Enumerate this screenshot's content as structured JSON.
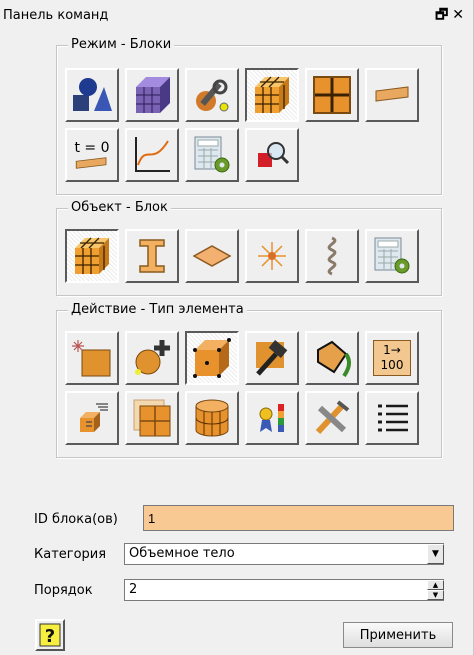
{
  "window": {
    "title": "Панель команд",
    "restore_icon": "restore-icon",
    "close_icon": "close-icon"
  },
  "groups": {
    "mode": {
      "label": "Режим - Блоки",
      "buttons": [
        {
          "name": "geometry-shapes-icon",
          "pressed": false
        },
        {
          "name": "mesh-cube-icon",
          "pressed": false
        },
        {
          "name": "tools-wrench-icon",
          "pressed": false
        },
        {
          "name": "block-cube-icon",
          "pressed": true
        },
        {
          "name": "grid-split-icon",
          "pressed": false
        },
        {
          "name": "plank-icon",
          "pressed": false
        },
        {
          "name": "initial-condition-icon",
          "label": "t = 0",
          "pressed": false
        },
        {
          "name": "graph-curve-icon",
          "pressed": false
        },
        {
          "name": "calculator-gear-icon",
          "pressed": false
        },
        {
          "name": "magnifier-icon",
          "pressed": false
        }
      ]
    },
    "object": {
      "label": "Объект - Блок",
      "buttons": [
        {
          "name": "block-cube-icon",
          "pressed": true
        },
        {
          "name": "beam-ibeam-icon",
          "pressed": false
        },
        {
          "name": "shell-plate-icon",
          "pressed": false
        },
        {
          "name": "node-star-icon",
          "pressed": false
        },
        {
          "name": "spring-icon",
          "pressed": false
        },
        {
          "name": "calculator-gear-icon",
          "pressed": false
        }
      ]
    },
    "action": {
      "label": "Действие - Тип элемента",
      "buttons": [
        {
          "name": "new-block-icon",
          "pressed": false
        },
        {
          "name": "add-element-icon",
          "pressed": false
        },
        {
          "name": "element-type-icon",
          "pressed": true
        },
        {
          "name": "hammer-icon",
          "pressed": false
        },
        {
          "name": "paint-bucket-icon",
          "pressed": false
        },
        {
          "name": "renumber-icon",
          "label": "1→\n100",
          "pressed": false
        },
        {
          "name": "list-cube-icon",
          "pressed": false
        },
        {
          "name": "split-block-icon",
          "pressed": false
        },
        {
          "name": "cylinder-icon",
          "pressed": false
        },
        {
          "name": "color-legend-icon",
          "pressed": false
        },
        {
          "name": "delete-tools-icon",
          "pressed": false
        },
        {
          "name": "list-icon",
          "pressed": false
        }
      ]
    }
  },
  "form": {
    "id_label": "ID блока(ов)",
    "id_value": "1",
    "category_label": "Категория",
    "category_value": "Объемное тело",
    "order_label": "Порядок",
    "order_value": "2"
  },
  "footer": {
    "help_icon": "help-question-icon",
    "apply_label": "Применить"
  },
  "colors": {
    "accent_orange": "#e89a3c",
    "field_highlight": "#f9c994",
    "panel_bg": "#f0f0f0"
  }
}
